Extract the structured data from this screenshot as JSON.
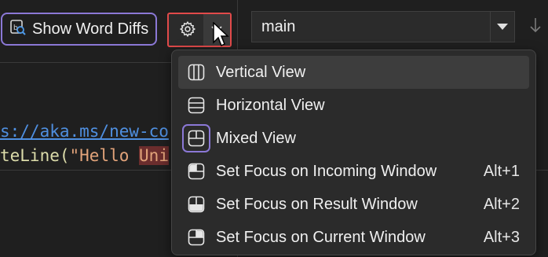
{
  "toolbar": {
    "word_diffs_label": "Show Word Diffs"
  },
  "editor": {
    "link_text": "s://aka.ms/new-co",
    "write_prefix": "teLine(",
    "write_string_start": "\"Hello ",
    "write_highlight": "Uni"
  },
  "branch": {
    "value": "main"
  },
  "menu": {
    "items": [
      {
        "label": "Vertical View",
        "shortcut": "",
        "icon": "vertical-view-icon"
      },
      {
        "label": "Horizontal View",
        "shortcut": "",
        "icon": "horizontal-view-icon"
      },
      {
        "label": "Mixed View",
        "shortcut": "",
        "icon": "mixed-view-icon"
      },
      {
        "label": "Set Focus on Incoming Window",
        "shortcut": "Alt+1",
        "icon": "focus-incoming-icon"
      },
      {
        "label": "Set Focus on Result Window",
        "shortcut": "Alt+2",
        "icon": "focus-result-icon"
      },
      {
        "label": "Set Focus on Current Window",
        "shortcut": "Alt+3",
        "icon": "focus-current-icon"
      }
    ]
  },
  "colors": {
    "accent_purple": "#8b78d6",
    "highlight_red": "#e14a4a",
    "menu_bg": "#2b2b2b",
    "editor_bg": "#1f1f1f"
  }
}
